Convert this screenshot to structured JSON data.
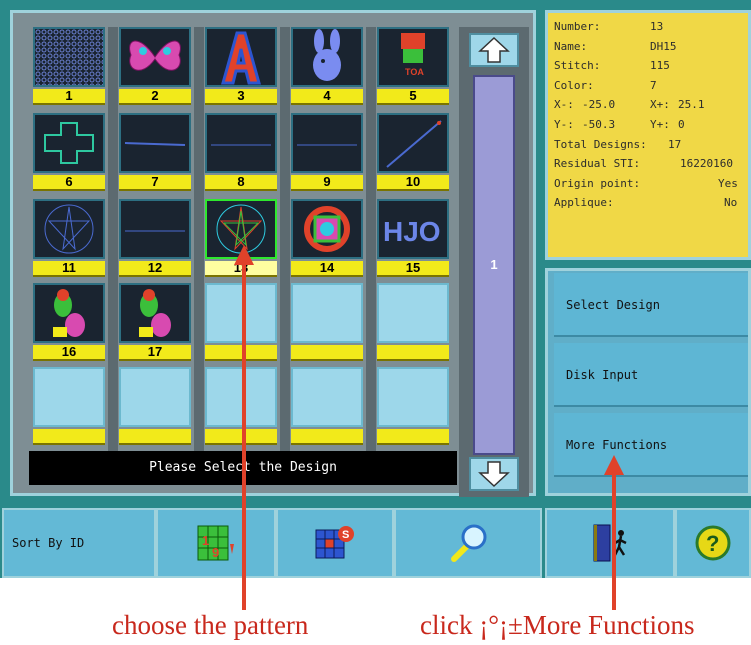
{
  "status_message": "Please Select the Design",
  "page_number": "1",
  "designs": [
    {
      "id": "1",
      "thumb": "pattern-mesh"
    },
    {
      "id": "2",
      "thumb": "butterfly"
    },
    {
      "id": "3",
      "thumb": "letter-a"
    },
    {
      "id": "4",
      "thumb": "bunny"
    },
    {
      "id": "5",
      "thumb": "logo-red"
    },
    {
      "id": "6",
      "thumb": "cross"
    },
    {
      "id": "7",
      "thumb": "line-h"
    },
    {
      "id": "8",
      "thumb": "line-h2"
    },
    {
      "id": "9",
      "thumb": "line-h3"
    },
    {
      "id": "10",
      "thumb": "line-diag"
    },
    {
      "id": "11",
      "thumb": "star-blue"
    },
    {
      "id": "12",
      "thumb": "line-h4"
    },
    {
      "id": "13",
      "thumb": "star-multicolor"
    },
    {
      "id": "14",
      "thumb": "circle-logo"
    },
    {
      "id": "15",
      "thumb": "text-hjo"
    },
    {
      "id": "16",
      "thumb": "parrots"
    },
    {
      "id": "17",
      "thumb": "parrots"
    },
    {
      "id": "",
      "thumb": "empty"
    },
    {
      "id": "",
      "thumb": "empty"
    },
    {
      "id": "",
      "thumb": "empty"
    },
    {
      "id": "",
      "thumb": "empty"
    },
    {
      "id": "",
      "thumb": "empty"
    },
    {
      "id": "",
      "thumb": "empty"
    },
    {
      "id": "",
      "thumb": "empty"
    },
    {
      "id": "",
      "thumb": "empty"
    }
  ],
  "info": {
    "number_label": "Number:",
    "number": "13",
    "name_label": "Name:",
    "name": "DH15",
    "stitch_label": "Stitch:",
    "stitch": "115",
    "color_label": "Color:",
    "color": "7",
    "xminus_label": "X-:",
    "xminus": "-25.0",
    "xplus_label": "X+:",
    "xplus": "25.1",
    "yminus_label": "Y-:",
    "yminus": "-50.3",
    "yplus_label": "Y+:",
    "yplus": "0",
    "total_label": "Total Designs:",
    "total": "17",
    "residual_label": "Residual STI:",
    "residual": "16220160",
    "origin_label": "Origin point:",
    "origin": "Yes",
    "applique_label": "Applique:",
    "applique": "No"
  },
  "functions": {
    "select_design": "Select Design",
    "disk_input": "Disk Input",
    "more_functions": "More Functions"
  },
  "toolbar": {
    "sort_by_id": "Sort By ID"
  },
  "annotations": {
    "choose_pattern": "choose the pattern",
    "click_more": "click ¡°¡±More Functions"
  },
  "colors": {
    "accent_yellow": "#f2ea1a",
    "annotation_red": "#e0422a",
    "panel_teal": "#2a8a8a"
  }
}
